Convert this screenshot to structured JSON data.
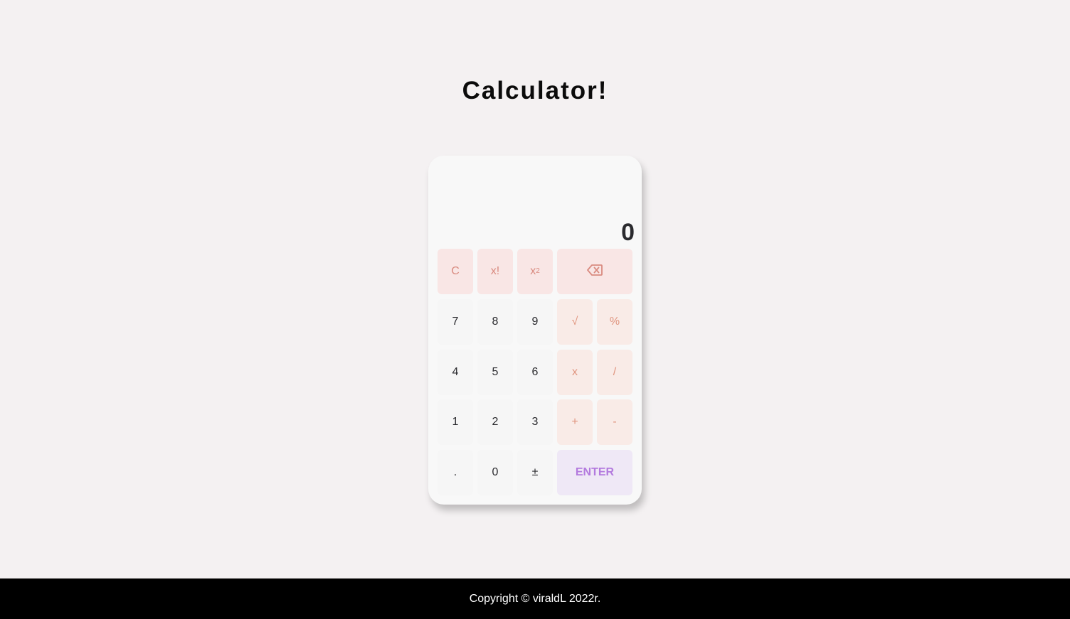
{
  "page": {
    "title": "Calculator!"
  },
  "display": {
    "value": "0"
  },
  "keys": {
    "clear": "C",
    "factorial": "x!",
    "square_base": "x",
    "square_exp": "2",
    "backspace_icon": "backspace-icon",
    "seven": "7",
    "eight": "8",
    "nine": "9",
    "sqrt": "√",
    "percent": "%",
    "four": "4",
    "five": "5",
    "six": "6",
    "multiply": "x",
    "divide": "/",
    "one": "1",
    "two": "2",
    "three": "3",
    "plus": "+",
    "minus": "-",
    "decimal": ".",
    "zero": "0",
    "plus_minus": "±",
    "enter": "ENTER"
  },
  "footer": {
    "text": "Copyright © viraldL 2022r."
  },
  "colors": {
    "background": "#f4f1f2",
    "calculator": "#f8f8f8",
    "function_key": "#f9e6e5",
    "operator_key": "#f9ebe7",
    "enter_key": "#efe8f6",
    "enter_text": "#b37ade",
    "accent_text": "#d98a7f",
    "footer_bg": "#000000"
  }
}
